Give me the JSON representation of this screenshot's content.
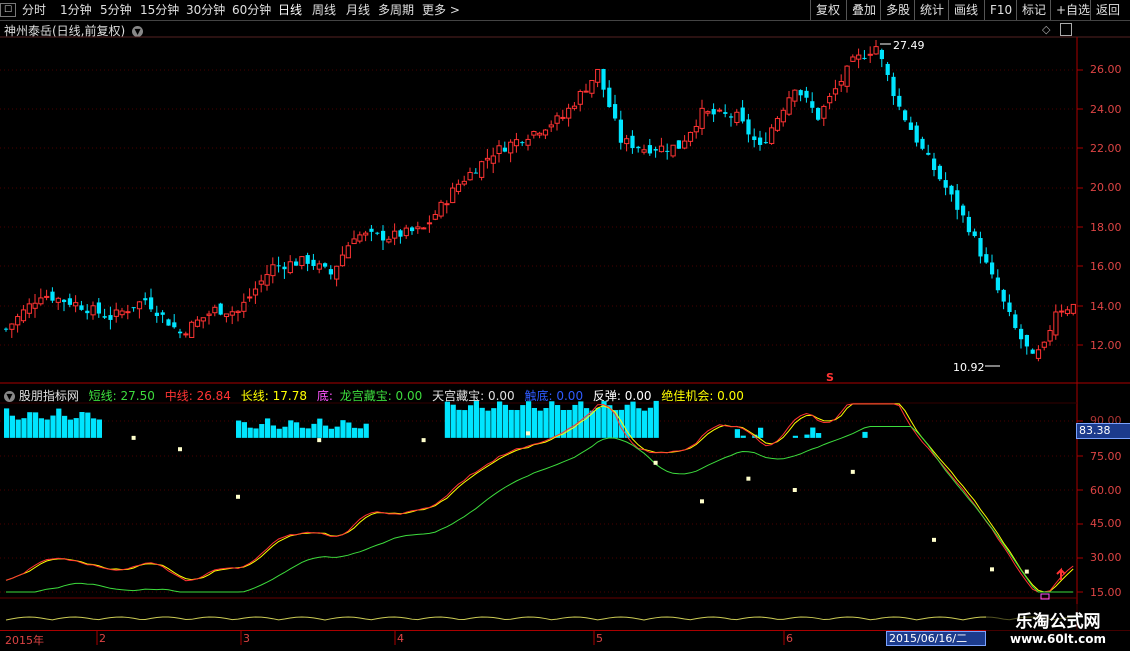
{
  "toolbar": {
    "periods": [
      "分时",
      "1分钟",
      "5分钟",
      "15分钟",
      "30分钟",
      "60分钟",
      "日线",
      "周线",
      "月线",
      "多周期",
      "更多 >"
    ],
    "right_buttons": [
      "复权",
      "叠加",
      "多股",
      "统计",
      "画线",
      "F10",
      "标记",
      "+自选",
      "返回"
    ]
  },
  "main": {
    "title": "神州泰岳(日线,前复权)",
    "high_label": "27.49",
    "low_label": "10.92",
    "s_mark": "S",
    "price_axis": [
      "26.00",
      "24.00",
      "22.00",
      "20.00",
      "18.00",
      "16.00",
      "14.00",
      "12.00"
    ]
  },
  "indicator": {
    "name": "股朋指标网",
    "items": [
      {
        "label": "短线: 27.50",
        "color": "#3ddc3d"
      },
      {
        "label": "中线: 26.84",
        "color": "#ff3333"
      },
      {
        "label": "长线: 17.78",
        "color": "#ffff00"
      },
      {
        "label": "底:",
        "color": "#ff55ff"
      },
      {
        "label": "龙宫藏宝: 0.00",
        "color": "#3ddc3d"
      },
      {
        "label": "天宫藏宝: 0.00",
        "color": "#e0e0e0"
      },
      {
        "label": "触底: 0.00",
        "color": "#2e5bff"
      },
      {
        "label": "反弹: 0.00",
        "color": "#ffffff"
      },
      {
        "label": "绝佳机会: 0.00",
        "color": "#ffff00"
      }
    ],
    "axis": [
      "75.00",
      "60.00",
      "45.00",
      "30.00",
      "15.00"
    ],
    "axis_top_partial": "90.00",
    "current_value": "83.38"
  },
  "date_axis": {
    "labels": [
      "2015年",
      "2",
      "3",
      "4",
      "5",
      "6"
    ],
    "selected_date": "2015/06/16/二"
  },
  "watermark": {
    "line1": "乐淘公式网",
    "line2": "www.60lt.com"
  },
  "colors": {
    "up": "#ff3333",
    "down": "#00e5ff",
    "axis": "#aa0000"
  }
}
